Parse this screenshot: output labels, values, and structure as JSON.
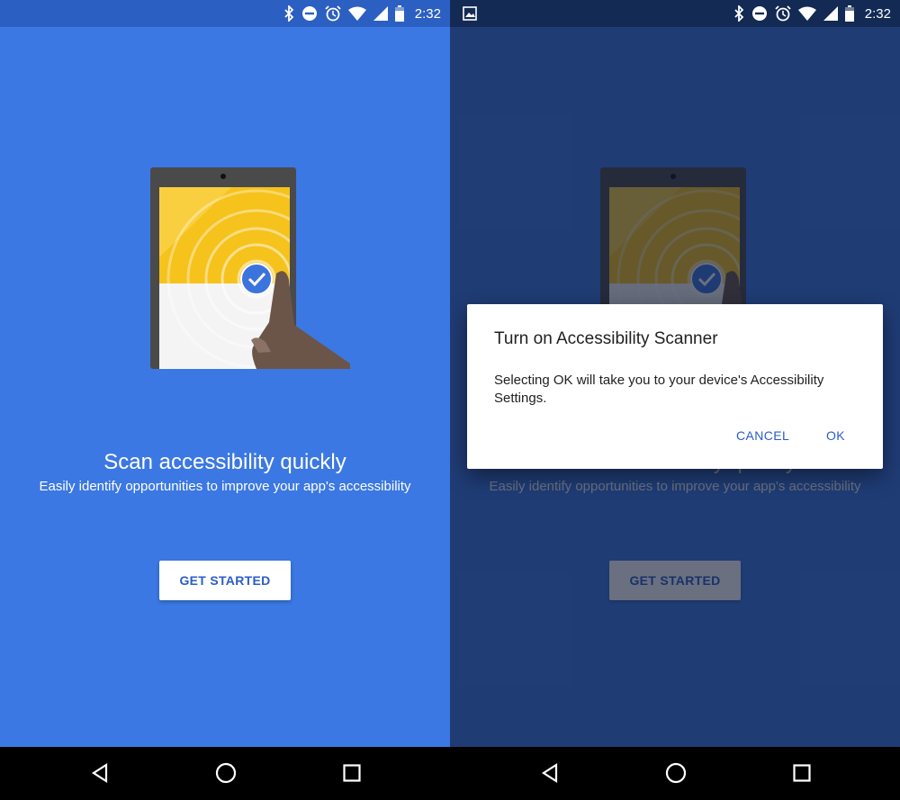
{
  "status_bar": {
    "time": "2:32"
  },
  "onboarding": {
    "headline": "Scan accessibility quickly",
    "subtext": "Easily identify opportunities to improve your app's accessibility",
    "cta_label": "GET STARTED"
  },
  "dialog": {
    "title": "Turn on Accessibility Scanner",
    "body": "Selecting OK will take you to your device's Accessibility Settings.",
    "cancel_label": "CANCEL",
    "ok_label": "OK"
  },
  "colors": {
    "background_blue": "#3b78e3",
    "status_bar_blue": "#2c5fc2",
    "accent": "#2b5cc7",
    "illustration_yellow": "#f6c21c",
    "check_blue": "#3a74dc"
  },
  "icons": [
    "bluetooth-icon",
    "do-not-disturb-icon",
    "alarm-icon",
    "wifi-icon",
    "signal-icon",
    "battery-icon",
    "gallery-notification-icon",
    "back-icon",
    "home-icon",
    "recents-icon",
    "check-icon"
  ]
}
